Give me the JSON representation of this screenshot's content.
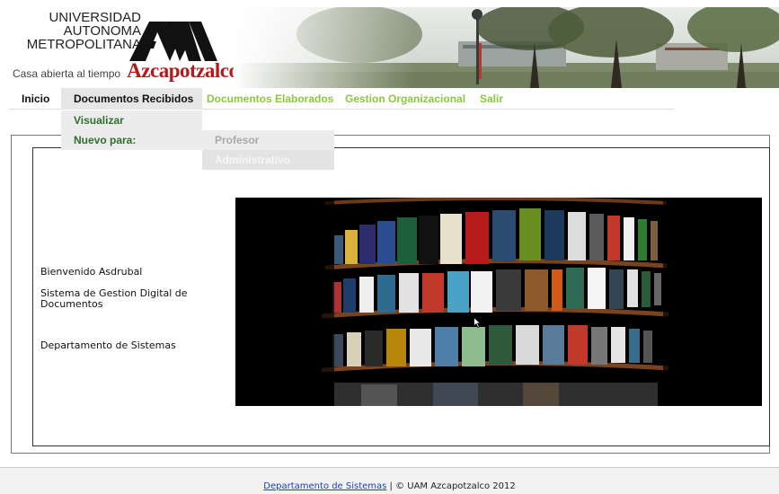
{
  "header": {
    "logo_line1": "UNIVERSIDAD",
    "logo_line2": "AUTONOMA",
    "logo_line3": "METROPOLITANA",
    "tagline": "Casa abierta al tiempo",
    "campus": "Azcapotzalco",
    "logo_icon": "uam-logo-icon",
    "photo": "campus-photo"
  },
  "nav": {
    "items": [
      {
        "label": "Inicio"
      },
      {
        "label": "Documentos Recibidos"
      },
      {
        "label": "Documentos Elaborados"
      },
      {
        "label": "Gestion Organizacional"
      },
      {
        "label": "Salir"
      }
    ],
    "accent_color": "#8cc63f",
    "active_bg": "#e6e6e6"
  },
  "dropdown": {
    "items": [
      {
        "label": "Visualizar"
      },
      {
        "label": "Nuevo para:"
      }
    ],
    "submenu": [
      {
        "label": "Profesor"
      },
      {
        "label": "Administrativo"
      }
    ],
    "text_color": "#2f6e2f"
  },
  "main": {
    "welcome": "Bienvenido Asdrubal",
    "system": "Sistema de Gestion Digital de Documentos",
    "department": "Departamento de Sistemas",
    "image": "bookshelf-image"
  },
  "footer": {
    "link": "Departamento de Sistemas",
    "rest": " | © UAM Azcapotzalco 2012",
    "link_color": "#1a3fbf"
  }
}
